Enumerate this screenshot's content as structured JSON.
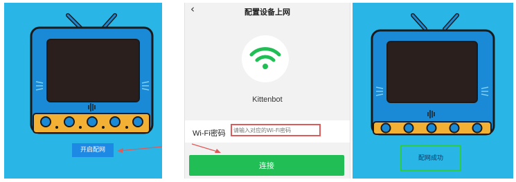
{
  "left_panel": {
    "start_button_label": "开启配网"
  },
  "phone": {
    "back_icon": "chevron-left-icon",
    "title": "配置设备上网",
    "wifi_icon": "wifi-icon",
    "device_name": "Kittenbot",
    "password_label": "Wi-Fi密码",
    "password_placeholder": "请输入对应的Wi-Fi密码",
    "password_value": "",
    "connect_label": "连接"
  },
  "right_panel": {
    "success_label": "配网成功"
  },
  "colors": {
    "panel_blue": "#29b6e6",
    "device_blue": "#1a8ad6",
    "screen": "#2b1f1d",
    "gold": "#f2b134",
    "wifi_green": "#21bd55",
    "connect_green": "#21bd55",
    "annotation_red": "#e05a5a",
    "success_border": "#2ecc40"
  }
}
